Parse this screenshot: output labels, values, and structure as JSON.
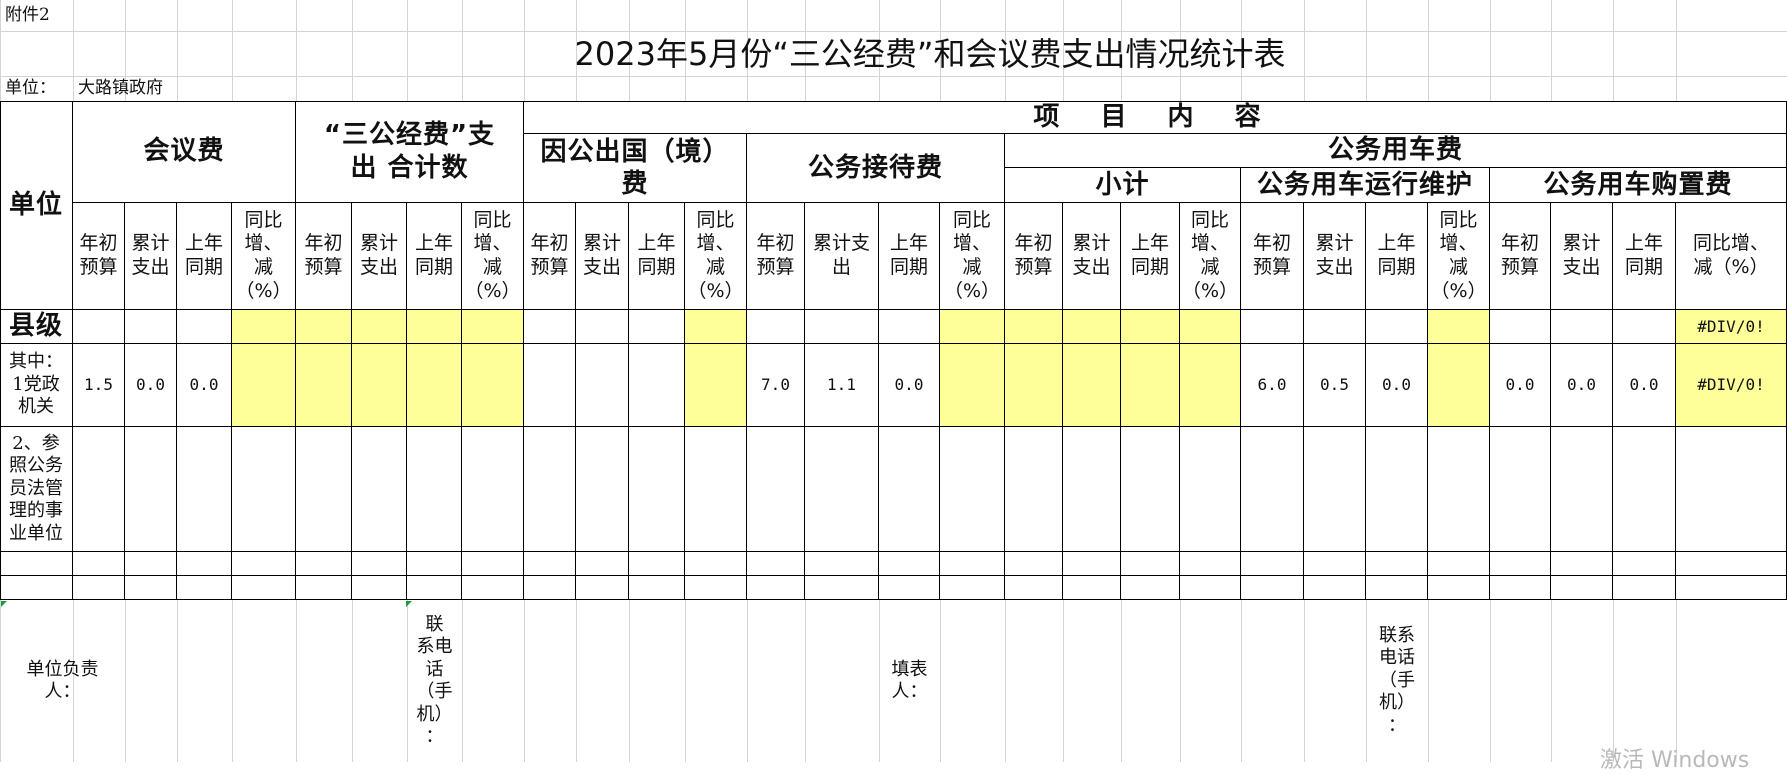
{
  "attachment": "附件2",
  "title": "2023年5月份“三公经费”和会议费支出情况统计表",
  "unit_label": "单位：",
  "unit_name": "大路镇政府",
  "headers": {
    "unit": "单位",
    "meeting": "会议费",
    "sangong_total": "“三公经费”支\n出    合计数",
    "project_content": "项 目 内 容",
    "abroad": "因公出国（境）\n费",
    "reception": "公务接待费",
    "vehicle": "公务用车费",
    "subtotal": "小计",
    "vehicle_run": "公务用车运行维护",
    "vehicle_buy": "公务用车购置费"
  },
  "subheaders": [
    "年初\n预算",
    "累计\n支出",
    "上年\n同期",
    "同比\n增、\n减\n（%）",
    "年初\n预算",
    "累计\n支出",
    "上年\n同期",
    "同比\n增、\n减\n（%）",
    "年初\n预算",
    "累计\n支出",
    "上年\n同期",
    "同比\n增、\n减\n（%）",
    "年初\n预算",
    "累计支\n出",
    "上年\n同期",
    "同比\n增、\n减\n（%）",
    "年初\n预算",
    "累计\n支出",
    "上年\n同期",
    "同比\n增、\n减\n（%）",
    "年初\n预算",
    "累计\n支出",
    "上年\n同期",
    "同比\n增、\n减\n（%）",
    "年初\n预算",
    "累计\n支出",
    "上年\n同期",
    "同比增、\n减（%）"
  ],
  "rows": {
    "county_label": "县级",
    "county_last": "#DIV/0!",
    "dang_label": "其中：\n1党政\n机关",
    "dang_values": [
      "1.5",
      "0.0",
      "0.0",
      "",
      "",
      "",
      "",
      "",
      "",
      "",
      "",
      "",
      "7.0",
      "1.1",
      "0.0",
      "",
      "",
      "",
      "",
      "",
      "6.0",
      "0.5",
      "0.0",
      "",
      "0.0",
      "0.0",
      "0.0",
      "#DIV/0!"
    ],
    "shiye_label": "2、参\n照公务\n员法管\n理的事\n业单位"
  },
  "footer": {
    "leader": "单位负责\n人：",
    "phone1": "联\n系电\n话\n（手\n机）\n：",
    "filler": "填表人：",
    "phone2": "联系\n电话\n（手\n机）\n："
  },
  "watermark": "激活 Windows",
  "colors": {
    "highlight": "#ffff99",
    "grid": "#d4d4d4",
    "border": "#000000"
  }
}
